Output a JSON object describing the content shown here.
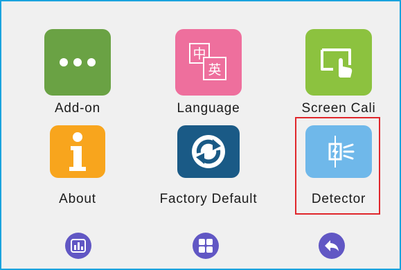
{
  "grid": {
    "tiles": [
      {
        "label": "Add-on",
        "icon": "ellipsis-icon",
        "color": "#6aa244"
      },
      {
        "label": "Language",
        "icon": "chinese-english-icon",
        "color": "#ee6f9d"
      },
      {
        "label": "Screen Cali",
        "icon": "touch-screen-icon",
        "color": "#8cc23f"
      },
      {
        "label": "About",
        "icon": "info-icon",
        "color": "#f8a51d"
      },
      {
        "label": "Factory Default",
        "icon": "refresh-icon",
        "color": "#1a5a86"
      },
      {
        "label": "Detector",
        "icon": "detector-icon",
        "color": "#6fb8ea"
      }
    ],
    "language_glyphs": [
      "中",
      "英"
    ],
    "highlight_color": "#e0262b"
  },
  "bottom_nav": [
    {
      "icon": "stats-icon",
      "color": "#6157c4"
    },
    {
      "icon": "home-grid-icon",
      "color": "#6157c4"
    },
    {
      "icon": "back-icon",
      "color": "#6157c4"
    }
  ]
}
